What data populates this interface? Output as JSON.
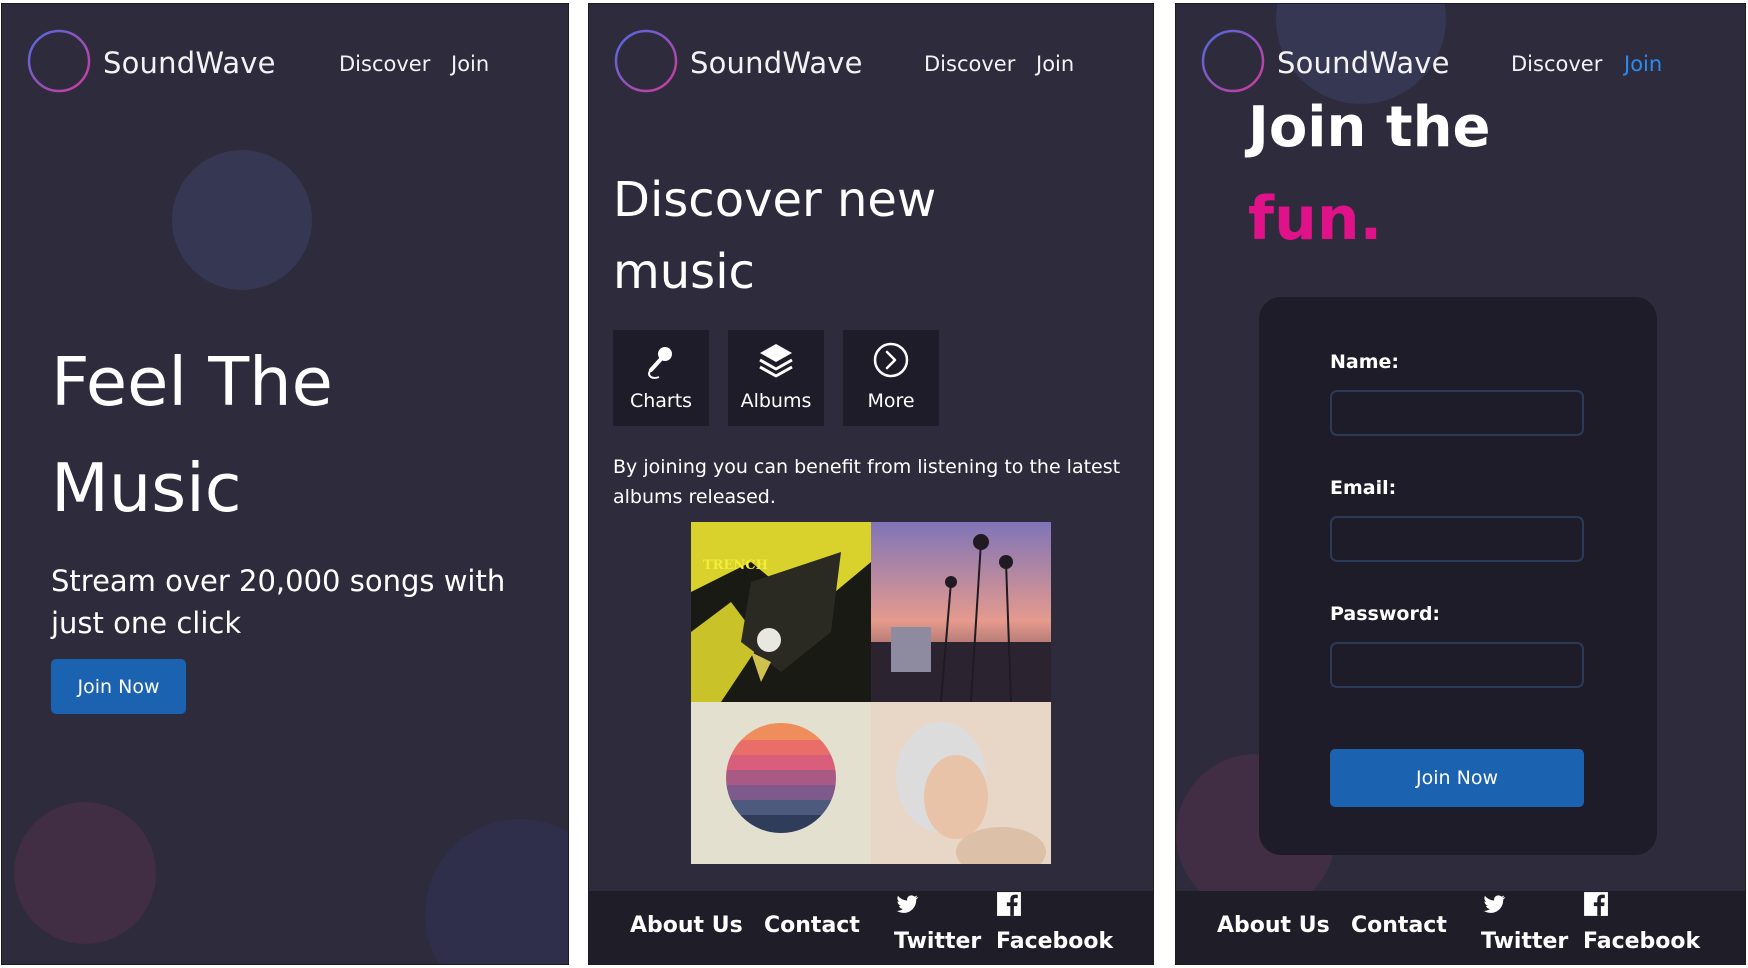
{
  "brand": {
    "name": "SoundWave",
    "logo_icon": "soundwave-logo-icon"
  },
  "nav": {
    "discover": "Discover",
    "join": "Join"
  },
  "colors": {
    "background": "#2e2b3c",
    "card": "#1e1c28",
    "accent_blue": "#1b63b0",
    "active_link": "#2a8cf0",
    "accent_pink": "#e0128a"
  },
  "home": {
    "title_line1": "Feel The",
    "title_line2": "Music",
    "subtitle": "Stream over 20,000 songs with just one click",
    "cta": "Join Now"
  },
  "discover": {
    "title_line1": "Discover new",
    "title_line2": "music",
    "cards": [
      {
        "label": "Charts",
        "icon": "microphone-icon"
      },
      {
        "label": "Albums",
        "icon": "layers-icon"
      },
      {
        "label": "More",
        "icon": "chevron-circle-icon"
      }
    ],
    "description": "By joining you can benefit from listening to the latest albums released.",
    "albums": [
      {
        "cover_text": "TRENCH"
      },
      {
        "cover_text": ""
      },
      {
        "cover_text": ""
      },
      {
        "cover_text": ""
      }
    ]
  },
  "footer": {
    "about": "About Us",
    "contact": "Contact",
    "twitter": "Twitter",
    "facebook": "Facebook"
  },
  "join": {
    "title": "Join the",
    "highlight": "fun.",
    "fields": {
      "name_label": "Name:",
      "email_label": "Email:",
      "password_label": "Password:"
    },
    "submit": "Join Now"
  }
}
